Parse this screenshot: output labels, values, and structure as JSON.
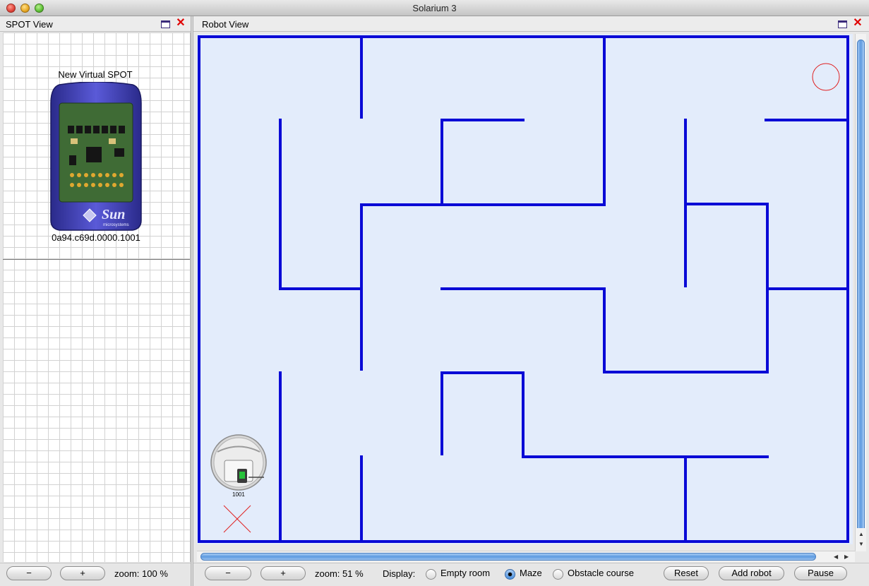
{
  "window": {
    "title": "Solarium 3"
  },
  "spot_view": {
    "title": "SPOT View",
    "spot_name": "New Virtual SPOT",
    "spot_address": "0a94.c69d.0000.1001",
    "device_brand": "Sun",
    "device_brand_sub": "microsystems",
    "zoom_out_label": "−",
    "zoom_in_label": "+",
    "zoom_text": "zoom: 100 %"
  },
  "robot_view": {
    "title": "Robot View",
    "robot_id_label": "1001",
    "zoom_out_label": "−",
    "zoom_in_label": "+",
    "zoom_text": "zoom: 51 %",
    "display_label": "Display:",
    "display_options": [
      "Empty room",
      "Maze",
      "Obstacle course"
    ],
    "display_selected": "Maze",
    "reset_label": "Reset",
    "add_robot_label": "Add robot",
    "pause_label": "Pause",
    "wall_color": "#0a0ad6",
    "floor_color": "#e3ecfb",
    "target_color": "#e02020"
  }
}
